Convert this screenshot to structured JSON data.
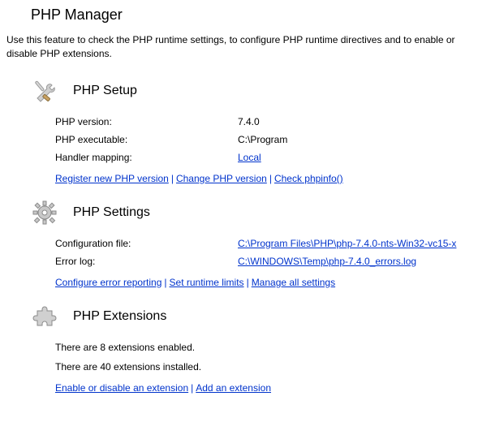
{
  "header": {
    "title": "PHP Manager",
    "description": "Use this feature to check the PHP runtime settings, to configure PHP runtime directives and to enable or disable PHP extensions."
  },
  "setup": {
    "title": "PHP Setup",
    "version_label": "PHP version:",
    "version_value": "7.4.0",
    "executable_label": "PHP executable:",
    "executable_value": "C:\\Program",
    "handler_label": "Handler mapping:",
    "handler_value": "Local",
    "link_register": "Register new PHP version",
    "link_change": "Change PHP version",
    "link_checkinfo": "Check phpinfo()"
  },
  "settings": {
    "title": "PHP Settings",
    "config_label": "Configuration file:",
    "config_value": "C:\\Program Files\\PHP\\php-7.4.0-nts-Win32-vc15-x",
    "errorlog_label": "Error log:",
    "errorlog_value": "C:\\WINDOWS\\Temp\\php-7.4.0_errors.log",
    "link_error_reporting": "Configure error reporting",
    "link_runtime_limits": "Set runtime limits",
    "link_manage_settings": "Manage all settings"
  },
  "extensions": {
    "title": "PHP Extensions",
    "enabled_text": "There are 8 extensions enabled.",
    "installed_text": "There are 40 extensions installed.",
    "link_enable_disable": "Enable or disable an extension",
    "link_add": "Add an extension"
  }
}
